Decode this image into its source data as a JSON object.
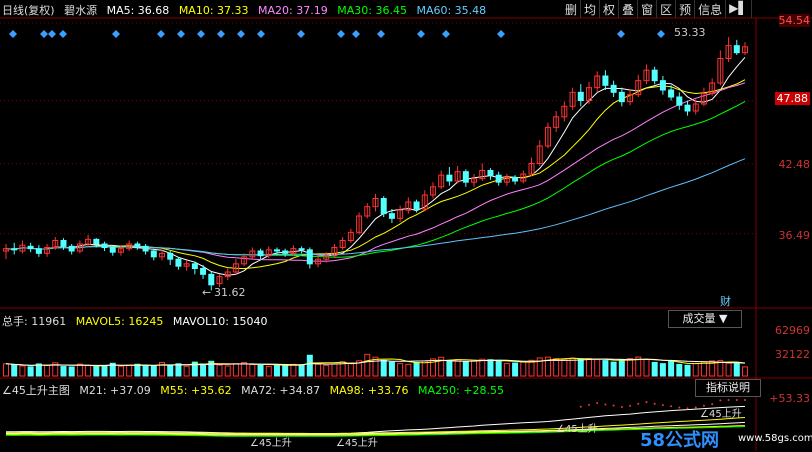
{
  "header_main": {
    "period": "日线(复权)",
    "stock": "碧水源",
    "ma5": "MA5: 36.68",
    "ma10": "MA10: 37.33",
    "ma20": "MA20: 37.19",
    "ma30": "MA30: 36.45",
    "ma60": "MA60: 35.48"
  },
  "toolbar": [
    "删",
    "均",
    "权",
    "叠",
    "窗",
    "区",
    "预",
    "信息"
  ],
  "price_labels": [
    "54.54",
    "47.88",
    "42.48",
    "36.49"
  ],
  "high_annotation": "53.33",
  "low_annotation": "31.62",
  "finance_marker": "财",
  "header_vol": {
    "total": "总手: 11961",
    "mavol5": "MAVOL5: 16245",
    "mavol10": "MAVOL10: 15040"
  },
  "vol_dropdown": "成交量",
  "vol_labels": [
    "62969",
    "32122"
  ],
  "header_ind": {
    "name": "∠45上升主图",
    "m21": "M21: +37.09",
    "m55": "M55: +35.62",
    "ma72": "MA72: +34.87",
    "ma98": "MA98: +33.76",
    "ma250": "MA250: +28.55"
  },
  "ind_button": "指标说明",
  "ind_label": "+53.33",
  "ind_text": [
    "∠45上升",
    "∠45上升",
    "∠45上升",
    "∠45上升"
  ],
  "watermark": [
    "58公式网",
    "www.58gs.com"
  ],
  "colors": {
    "ma5": "#ffffff",
    "ma10": "#ffff00",
    "ma20": "#ff80ff",
    "ma30": "#00ff00",
    "ma60": "#60c0ff",
    "up": "#ff3232",
    "down": "#54ffff",
    "grid": "#800000"
  },
  "chart_data": {
    "type": "candlestick",
    "price_axis": [
      36.49,
      42.48,
      47.88,
      54.54
    ],
    "candles": [
      [
        35.0,
        35.2,
        34.3,
        35.6
      ],
      [
        35.2,
        35.1,
        34.7,
        35.7
      ],
      [
        35.0,
        35.5,
        34.8,
        35.9
      ],
      [
        35.4,
        35.2,
        34.9,
        35.7
      ],
      [
        35.2,
        34.8,
        34.5,
        35.5
      ],
      [
        34.8,
        35.3,
        34.5,
        35.6
      ],
      [
        35.3,
        35.9,
        35.1,
        36.2
      ],
      [
        35.9,
        35.4,
        35.1,
        36.1
      ],
      [
        35.4,
        35.0,
        34.7,
        35.6
      ],
      [
        35.0,
        35.6,
        34.8,
        35.9
      ],
      [
        35.6,
        36.0,
        35.3,
        36.4
      ],
      [
        36.0,
        35.6,
        35.3,
        36.1
      ],
      [
        35.6,
        35.3,
        35.0,
        35.8
      ],
      [
        35.3,
        34.9,
        34.6,
        35.5
      ],
      [
        34.9,
        35.2,
        34.6,
        35.5
      ],
      [
        35.2,
        35.6,
        35.0,
        35.9
      ],
      [
        35.6,
        35.4,
        35.1,
        35.8
      ],
      [
        35.4,
        35.0,
        34.7,
        35.6
      ],
      [
        35.0,
        34.5,
        34.2,
        35.2
      ],
      [
        34.5,
        34.8,
        34.2,
        35.1
      ],
      [
        34.8,
        34.3,
        33.8,
        35.0
      ],
      [
        34.3,
        33.7,
        33.4,
        34.5
      ],
      [
        33.7,
        33.9,
        33.3,
        34.2
      ],
      [
        33.9,
        33.5,
        33.0,
        34.1
      ],
      [
        33.5,
        33.0,
        32.6,
        33.8
      ],
      [
        33.0,
        32.1,
        31.62,
        33.2
      ],
      [
        32.2,
        32.8,
        31.9,
        33.0
      ],
      [
        32.8,
        33.2,
        32.5,
        33.5
      ],
      [
        33.2,
        33.9,
        33.0,
        34.3
      ],
      [
        33.9,
        34.5,
        33.7,
        34.8
      ],
      [
        34.5,
        35.0,
        34.3,
        35.3
      ],
      [
        35.0,
        34.6,
        34.3,
        35.2
      ],
      [
        34.6,
        35.1,
        34.4,
        35.4
      ],
      [
        35.1,
        35.0,
        34.7,
        35.3
      ],
      [
        35.0,
        34.8,
        34.5,
        35.2
      ],
      [
        34.8,
        35.2,
        34.6,
        35.5
      ],
      [
        35.2,
        35.1,
        34.8,
        35.4
      ],
      [
        35.1,
        33.9,
        33.5,
        35.3
      ],
      [
        33.9,
        34.3,
        33.6,
        34.7
      ],
      [
        34.3,
        34.6,
        34.0,
        34.9
      ],
      [
        34.6,
        35.3,
        34.4,
        35.6
      ],
      [
        35.3,
        35.9,
        35.1,
        36.2
      ],
      [
        35.9,
        36.6,
        35.7,
        36.9
      ],
      [
        36.6,
        38.0,
        36.4,
        38.3
      ],
      [
        38.0,
        38.8,
        37.8,
        39.1
      ],
      [
        38.8,
        39.5,
        38.4,
        39.9
      ],
      [
        39.5,
        38.2,
        37.9,
        39.7
      ],
      [
        38.2,
        37.8,
        37.4,
        38.6
      ],
      [
        37.8,
        38.5,
        37.5,
        38.9
      ],
      [
        38.5,
        39.2,
        38.2,
        39.6
      ],
      [
        39.2,
        38.6,
        38.3,
        39.4
      ],
      [
        38.6,
        39.8,
        38.4,
        40.2
      ],
      [
        39.8,
        40.5,
        39.5,
        40.9
      ],
      [
        40.5,
        41.5,
        40.3,
        41.9
      ],
      [
        41.5,
        41.0,
        40.6,
        42.2
      ],
      [
        41.0,
        41.8,
        40.8,
        42.3
      ],
      [
        41.8,
        40.9,
        40.5,
        42.0
      ],
      [
        40.9,
        41.2,
        40.5,
        41.6
      ],
      [
        41.2,
        41.9,
        41.0,
        42.5
      ],
      [
        41.9,
        41.5,
        41.1,
        42.1
      ],
      [
        41.5,
        40.9,
        40.6,
        41.8
      ],
      [
        40.9,
        41.3,
        40.6,
        41.6
      ],
      [
        41.3,
        41.0,
        40.7,
        41.5
      ],
      [
        41.0,
        41.6,
        40.8,
        41.9
      ],
      [
        41.6,
        42.5,
        41.4,
        43.0
      ],
      [
        42.5,
        44.0,
        42.3,
        44.5
      ],
      [
        44.0,
        45.6,
        43.8,
        46.0
      ],
      [
        45.6,
        46.5,
        45.2,
        47.0
      ],
      [
        46.5,
        47.4,
        46.1,
        47.8
      ],
      [
        47.4,
        48.6,
        47.1,
        49.0
      ],
      [
        48.6,
        47.9,
        47.4,
        49.3
      ],
      [
        47.9,
        49.0,
        47.6,
        49.5
      ],
      [
        49.0,
        50.0,
        48.6,
        50.4
      ],
      [
        50.0,
        49.2,
        48.8,
        50.5
      ],
      [
        49.2,
        48.6,
        48.2,
        49.6
      ],
      [
        48.6,
        47.8,
        47.4,
        49.0
      ],
      [
        47.8,
        48.4,
        47.5,
        48.9
      ],
      [
        48.4,
        49.6,
        48.2,
        50.1
      ],
      [
        49.6,
        50.5,
        49.3,
        51.0
      ],
      [
        50.5,
        49.6,
        49.3,
        50.8
      ],
      [
        49.6,
        48.8,
        48.4,
        50.0
      ],
      [
        48.8,
        48.2,
        47.9,
        49.2
      ],
      [
        48.2,
        47.5,
        47.1,
        48.6
      ],
      [
        47.5,
        47.0,
        46.6,
        47.9
      ],
      [
        47.0,
        47.6,
        46.7,
        48.0
      ],
      [
        47.6,
        48.5,
        47.4,
        49.0
      ],
      [
        48.5,
        49.4,
        48.3,
        49.8
      ],
      [
        49.4,
        51.5,
        49.2,
        52.2
      ],
      [
        51.5,
        52.6,
        51.2,
        53.33
      ],
      [
        52.6,
        52.0,
        51.8,
        53.1
      ],
      [
        52.0,
        52.5,
        51.8,
        52.9
      ]
    ],
    "volume": [
      16000,
      14500,
      13200,
      12000,
      15800,
      14100,
      17300,
      12400,
      11800,
      15600,
      13700,
      12900,
      13500,
      16700,
      12800,
      14400,
      15400,
      13100,
      12600,
      17800,
      14200,
      16000,
      12700,
      18200,
      15800,
      19300,
      14300,
      13200,
      16300,
      17800,
      15000,
      13900,
      12600,
      14800,
      13400,
      15300,
      14700,
      27200,
      15300,
      14000,
      15800,
      18600,
      17200,
      19900,
      28400,
      24700,
      20600,
      18100,
      16200,
      15300,
      17800,
      19800,
      22400,
      24600,
      19600,
      21400,
      18700,
      20000,
      22000,
      21300,
      19200,
      16300,
      17000,
      18300,
      20600,
      23700,
      24700,
      22800,
      21400,
      23600,
      21800,
      22800,
      21500,
      20200,
      18200,
      21200,
      23000,
      24900,
      22000,
      17800,
      16200,
      19700,
      15200,
      14000,
      16500,
      18600,
      19800,
      20200,
      17000,
      16300,
      11961
    ],
    "vol_axis": [
      32122,
      62969
    ],
    "indicator_lines": [
      "M21: +37.09",
      "M55: +35.62",
      "MA72: +34.87",
      "MA98: +33.76",
      "MA250: +28.55"
    ]
  }
}
